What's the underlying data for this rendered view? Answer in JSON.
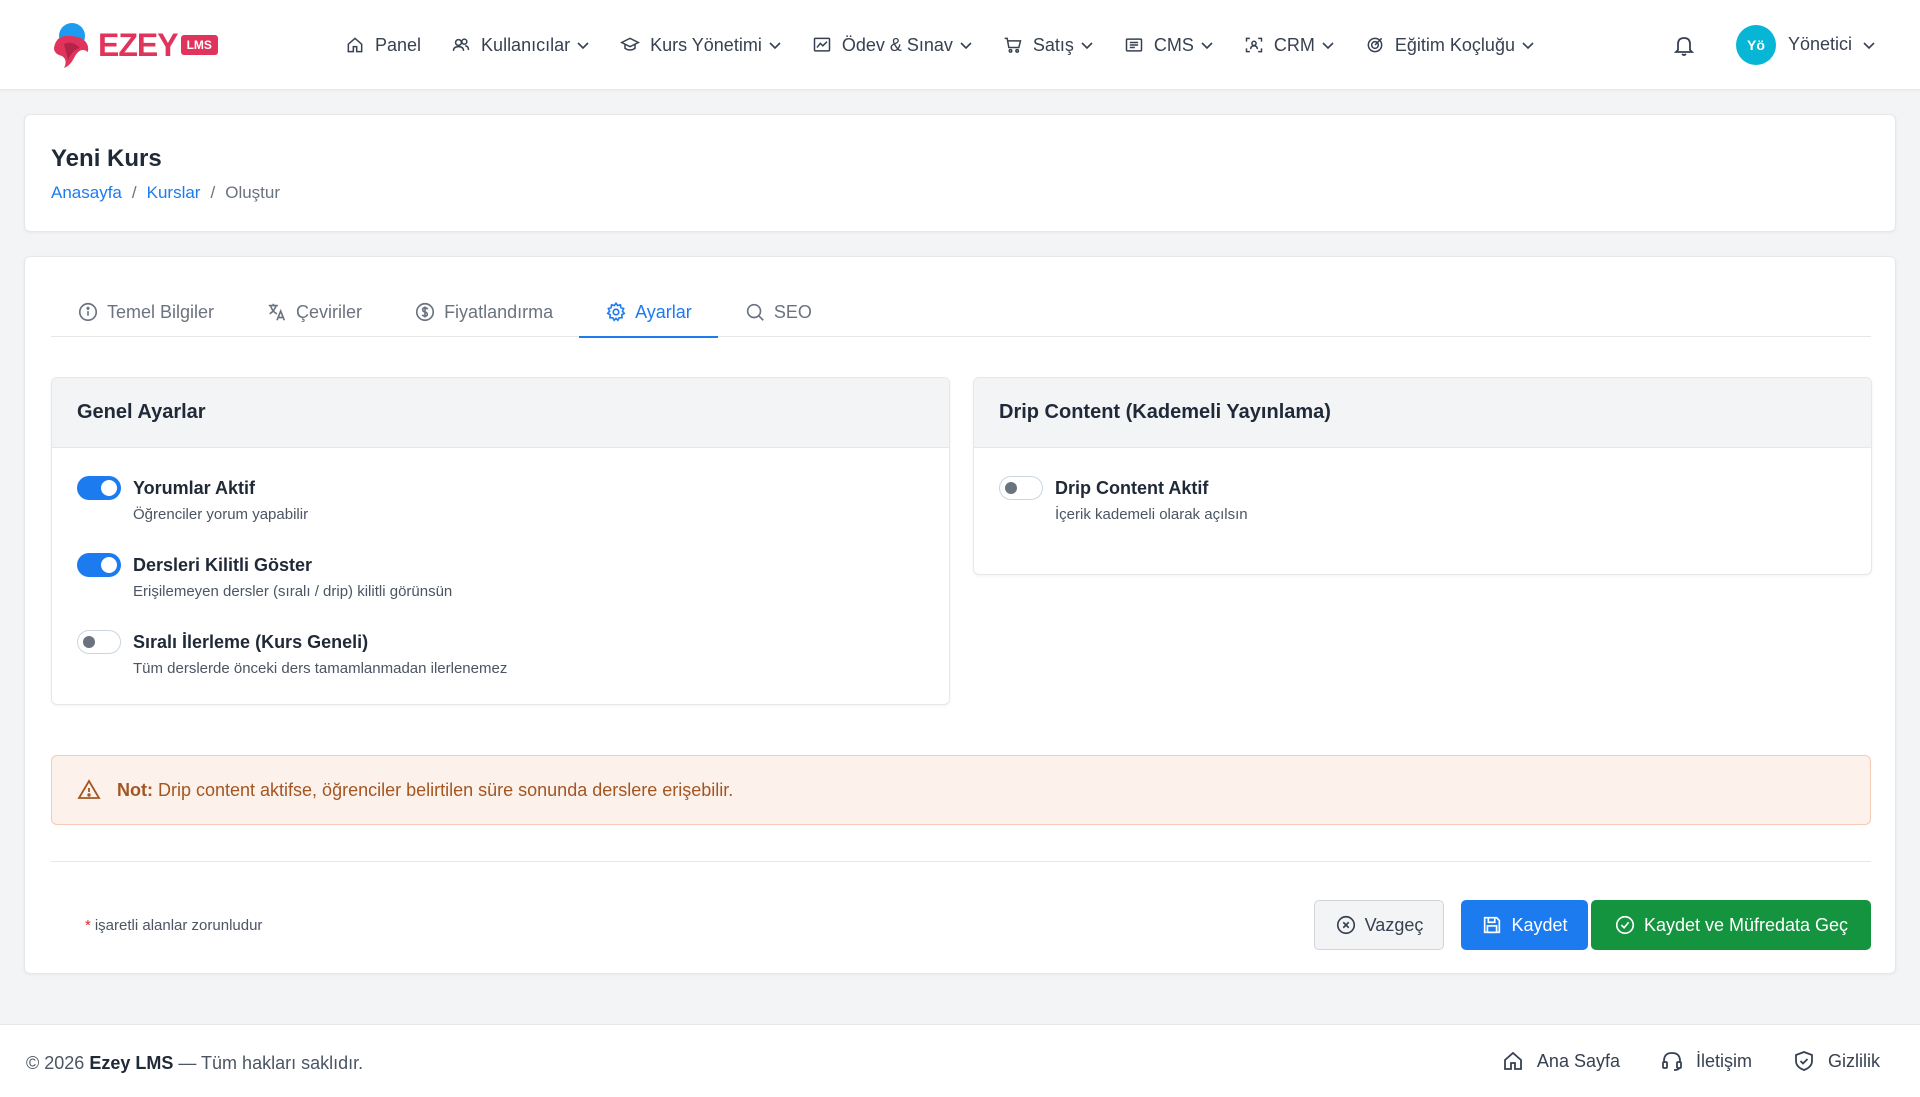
{
  "brand": {
    "name": "EZEY",
    "badge": "LMS",
    "color": "#e0345c"
  },
  "nav": {
    "items": [
      {
        "label": "Panel",
        "icon": "home-icon"
      },
      {
        "label": "Kullanıcılar",
        "icon": "users-icon"
      },
      {
        "label": "Kurs Yönetimi",
        "icon": "graduation-cap-icon"
      },
      {
        "label": "Ödev & Sınav",
        "icon": "chart-board-icon"
      },
      {
        "label": "Satış",
        "icon": "cart-icon"
      },
      {
        "label": "CMS",
        "icon": "newspaper-icon"
      },
      {
        "label": "CRM",
        "icon": "user-scan-icon"
      },
      {
        "label": "Eğitim Koçluğu",
        "icon": "target-icon"
      }
    ],
    "user": {
      "initials": "Yö",
      "name": "Yönetici"
    }
  },
  "header": {
    "title": "Yeni Kurs",
    "breadcrumb": [
      "Anasayfa",
      "Kurslar",
      "Oluştur"
    ]
  },
  "tabs": [
    {
      "label": "Temel Bilgiler",
      "icon": "info-icon",
      "active": false
    },
    {
      "label": "Çeviriler",
      "icon": "translate-icon",
      "active": false
    },
    {
      "label": "Fiyatlandırma",
      "icon": "dollar-icon",
      "active": false
    },
    {
      "label": "Ayarlar",
      "icon": "gear-icon",
      "active": true
    },
    {
      "label": "SEO",
      "icon": "search-icon",
      "active": false
    }
  ],
  "general": {
    "title": "Genel Ayarlar",
    "settings": [
      {
        "title": "Yorumlar Aktif",
        "desc": "Öğrenciler yorum yapabilir",
        "on": true
      },
      {
        "title": "Dersleri Kilitli Göster",
        "desc": "Erişilemeyen dersler (sıralı / drip) kilitli görünsün",
        "on": true
      },
      {
        "title": "Sıralı İlerleme (Kurs Geneli)",
        "desc": "Tüm derslerde önceki ders tamamlanmadan ilerlenemez",
        "on": false
      }
    ]
  },
  "drip": {
    "title": "Drip Content (Kademeli Yayınlama)",
    "settings": [
      {
        "title": "Drip Content Aktif",
        "desc": "İçerik kademeli olarak açılsın",
        "on": false
      }
    ]
  },
  "alert": {
    "bold": "Not:",
    "text": "Drip content aktifse, öğrenciler belirtilen süre sonunda derslere erişebilir."
  },
  "form": {
    "required_star": "*",
    "required_note": "işaretli alanlar zorunludur",
    "cancel_label": "Vazgeç",
    "save_label": "Kaydet",
    "save_next_label": "Kaydet ve Müfredata Geç"
  },
  "footer": {
    "year": "© 2026",
    "brand": "Ezey LMS",
    "rights": "— Tüm hakları saklıdır.",
    "links": [
      {
        "label": "Ana Sayfa",
        "icon": "home-icon"
      },
      {
        "label": "İletişim",
        "icon": "headset-icon"
      },
      {
        "label": "Gizlilik",
        "icon": "shield-check-icon"
      }
    ]
  }
}
